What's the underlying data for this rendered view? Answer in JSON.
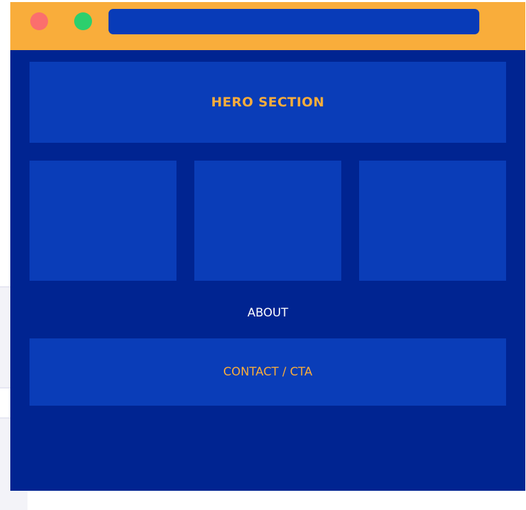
{
  "colors": {
    "titlebar": "#f9ad3b",
    "page_background": "#002491",
    "block": "#0a3db8",
    "close_dot": "#fb6f6d",
    "maximize_dot": "#2ccf6d",
    "accent_text": "#f9ad3b",
    "white_text": "#ffffff"
  },
  "window": {
    "titlebar": {
      "controls": [
        {
          "name": "close-dot-icon",
          "color": "#fb6f6d"
        },
        {
          "name": "maximize-dot-icon",
          "color": "#2ccf6d"
        }
      ],
      "address_bar_text": ""
    },
    "hero": {
      "label": "HERO SECTION"
    },
    "cards": [
      {
        "label": ""
      },
      {
        "label": ""
      },
      {
        "label": ""
      }
    ],
    "about": {
      "label": "ABOUT"
    },
    "contact": {
      "label": "CONTACT / CTA"
    }
  }
}
